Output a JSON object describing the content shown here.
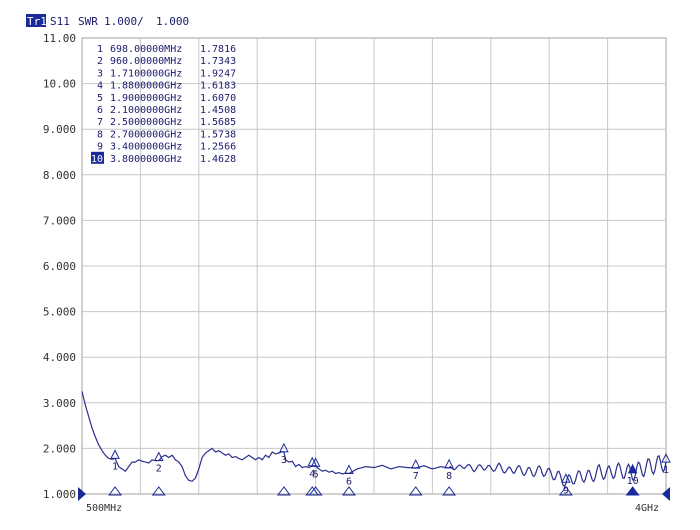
{
  "header": {
    "trace_tag": "Tr1",
    "parameter": "S11",
    "format": "SWR",
    "scale": "1.000/",
    "reference": "1.000"
  },
  "y_axis": {
    "ticks": [
      "11.00",
      "10.00",
      "9.000",
      "8.000",
      "7.000",
      "6.000",
      "5.000",
      "4.000",
      "3.000",
      "2.000",
      "1.000"
    ]
  },
  "x_axis": {
    "start_label": "500MHz",
    "stop_label": "4GHz"
  },
  "marker_table": [
    {
      "num": "1",
      "freq": "698.00000MHz",
      "value": "1.7816"
    },
    {
      "num": "2",
      "freq": "960.00000MHz",
      "value": "1.7343"
    },
    {
      "num": "3",
      "freq": "1.7100000GHz",
      "value": "1.9247"
    },
    {
      "num": "4",
      "freq": "1.8800000GHz",
      "value": "1.6183"
    },
    {
      "num": "5",
      "freq": "1.9000000GHz",
      "value": "1.6070"
    },
    {
      "num": "6",
      "freq": "2.1000000GHz",
      "value": "1.4508"
    },
    {
      "num": "7",
      "freq": "2.5000000GHz",
      "value": "1.5685"
    },
    {
      "num": "8",
      "freq": "2.7000000GHz",
      "value": "1.5738"
    },
    {
      "num": "9",
      "freq": "3.4000000GHz",
      "value": "1.2566"
    },
    {
      "num": "10",
      "freq": "3.8000000GHz",
      "value": "1.4628",
      "active": true
    }
  ],
  "colors": {
    "trace": "#2a2e8c",
    "grid": "#c8c8c8",
    "text": "#1a1a6e",
    "active_bg": "#1a2a9a",
    "marker": "#1a2a9a"
  },
  "chart_data": {
    "type": "line",
    "xlim": [
      500,
      4000
    ],
    "ylim": [
      1,
      11
    ],
    "x_unit": "MHz",
    "series": [
      {
        "x": [
          500,
          520,
          540,
          560,
          580,
          600,
          620,
          640,
          660,
          680,
          698,
          720,
          740,
          760,
          780,
          800,
          820,
          840,
          860,
          880,
          900,
          920,
          940,
          960,
          980,
          1000,
          1020,
          1040,
          1060,
          1080,
          1100,
          1120,
          1140,
          1160,
          1180,
          1200,
          1220,
          1240,
          1260,
          1280,
          1300,
          1320,
          1340,
          1360,
          1380,
          1400,
          1420,
          1440,
          1460,
          1480,
          1500,
          1520,
          1540,
          1560,
          1580,
          1600,
          1620,
          1640,
          1660,
          1680,
          1700,
          1710,
          1720,
          1740,
          1760,
          1780,
          1800,
          1820,
          1840,
          1860,
          1880,
          1900,
          1920,
          1940,
          1960,
          1980,
          2000,
          2020,
          2040,
          2060,
          2080,
          2100,
          2150,
          2200,
          2250,
          2300,
          2350,
          2400,
          2450,
          2500,
          2550,
          2600,
          2650,
          2700,
          2750,
          2800,
          2850,
          2900,
          2950,
          3000,
          3050,
          3100,
          3150,
          3200,
          3250,
          3300,
          3350,
          3400,
          3450,
          3500,
          3550,
          3600,
          3650,
          3700,
          3750,
          3800,
          3850,
          3900,
          3950,
          4000
        ],
        "y": [
          3.25,
          2.95,
          2.7,
          2.45,
          2.25,
          2.08,
          1.95,
          1.85,
          1.78,
          1.76,
          1.78,
          1.6,
          1.55,
          1.5,
          1.6,
          1.7,
          1.7,
          1.75,
          1.72,
          1.7,
          1.68,
          1.75,
          1.73,
          1.73,
          1.82,
          1.85,
          1.8,
          1.85,
          1.75,
          1.7,
          1.6,
          1.4,
          1.3,
          1.28,
          1.35,
          1.55,
          1.8,
          1.9,
          1.95,
          2.0,
          1.92,
          1.95,
          1.9,
          1.85,
          1.88,
          1.8,
          1.82,
          1.78,
          1.75,
          1.8,
          1.85,
          1.8,
          1.75,
          1.8,
          1.75,
          1.85,
          1.8,
          1.92,
          1.88,
          1.9,
          1.93,
          1.92,
          1.75,
          1.7,
          1.72,
          1.6,
          1.65,
          1.58,
          1.6,
          1.58,
          1.62,
          1.61,
          1.55,
          1.5,
          1.52,
          1.48,
          1.5,
          1.45,
          1.47,
          1.44,
          1.46,
          1.45,
          1.55,
          1.6,
          1.58,
          1.63,
          1.55,
          1.6,
          1.58,
          1.57,
          1.62,
          1.55,
          1.6,
          1.57,
          1.58,
          1.62,
          1.55,
          1.6,
          1.55,
          1.6,
          1.5,
          1.55,
          1.5,
          1.48,
          1.52,
          1.45,
          1.4,
          1.26,
          1.35,
          1.4,
          1.38,
          1.5,
          1.45,
          1.52,
          1.5,
          1.46,
          1.55,
          1.6,
          1.65,
          1.7
        ]
      }
    ],
    "markers": [
      {
        "id": "1",
        "x": 698,
        "y": 1.7816
      },
      {
        "id": "2",
        "x": 960,
        "y": 1.7343
      },
      {
        "id": "3",
        "x": 1710,
        "y": 1.9247
      },
      {
        "id": "4",
        "x": 1880,
        "y": 1.6183
      },
      {
        "id": "5",
        "x": 1900,
        "y": 1.607
      },
      {
        "id": "6",
        "x": 2100,
        "y": 1.4508
      },
      {
        "id": "7",
        "x": 2500,
        "y": 1.5685
      },
      {
        "id": "8",
        "x": 2700,
        "y": 1.5738
      },
      {
        "id": "9",
        "x": 3400,
        "y": 1.2566
      },
      {
        "id": "10",
        "x": 3800,
        "y": 1.4628
      },
      {
        "id": "1",
        "x": 4000,
        "y": 1.7
      }
    ],
    "grid": true
  }
}
